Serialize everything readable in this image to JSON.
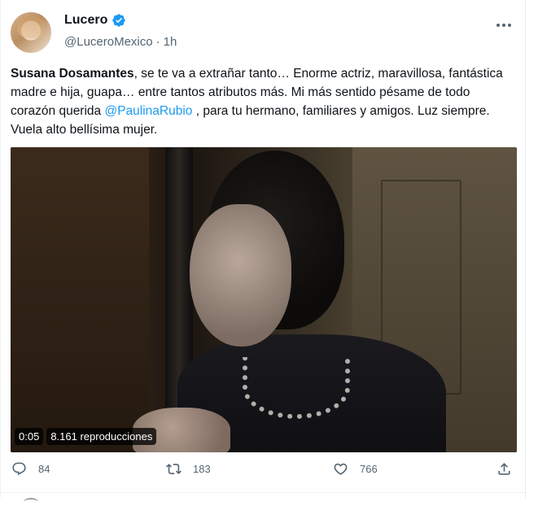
{
  "tweet": {
    "display_name": "Lucero",
    "handle": "@LuceroMexico",
    "separator": "·",
    "time": "1h",
    "text_bold": "Susana Dosamantes",
    "text_part1": ", se te va a extrañar tanto… Enorme actriz, maravillosa, fantástica madre e hija, guapa… entre tantos atributos más. Mi más sentido pésame de todo corazón querida ",
    "mention": "@PaulinaRubio",
    "text_part2": " , para tu hermano, familiares y amigos. Luz siempre. Vuela alto bellísima mujer."
  },
  "video": {
    "duration": "0:05",
    "views": "8.161 reproducciones"
  },
  "actions": {
    "replies": "84",
    "retweets": "183",
    "likes": "766"
  },
  "icons": {
    "verified": "verified-badge-icon",
    "more": "more-options-icon",
    "reply": "reply-icon",
    "retweet": "retweet-icon",
    "like": "heart-icon",
    "share": "share-icon"
  },
  "colors": {
    "accent": "#1d9bf0",
    "text": "#0f1419",
    "muted": "#536471"
  }
}
